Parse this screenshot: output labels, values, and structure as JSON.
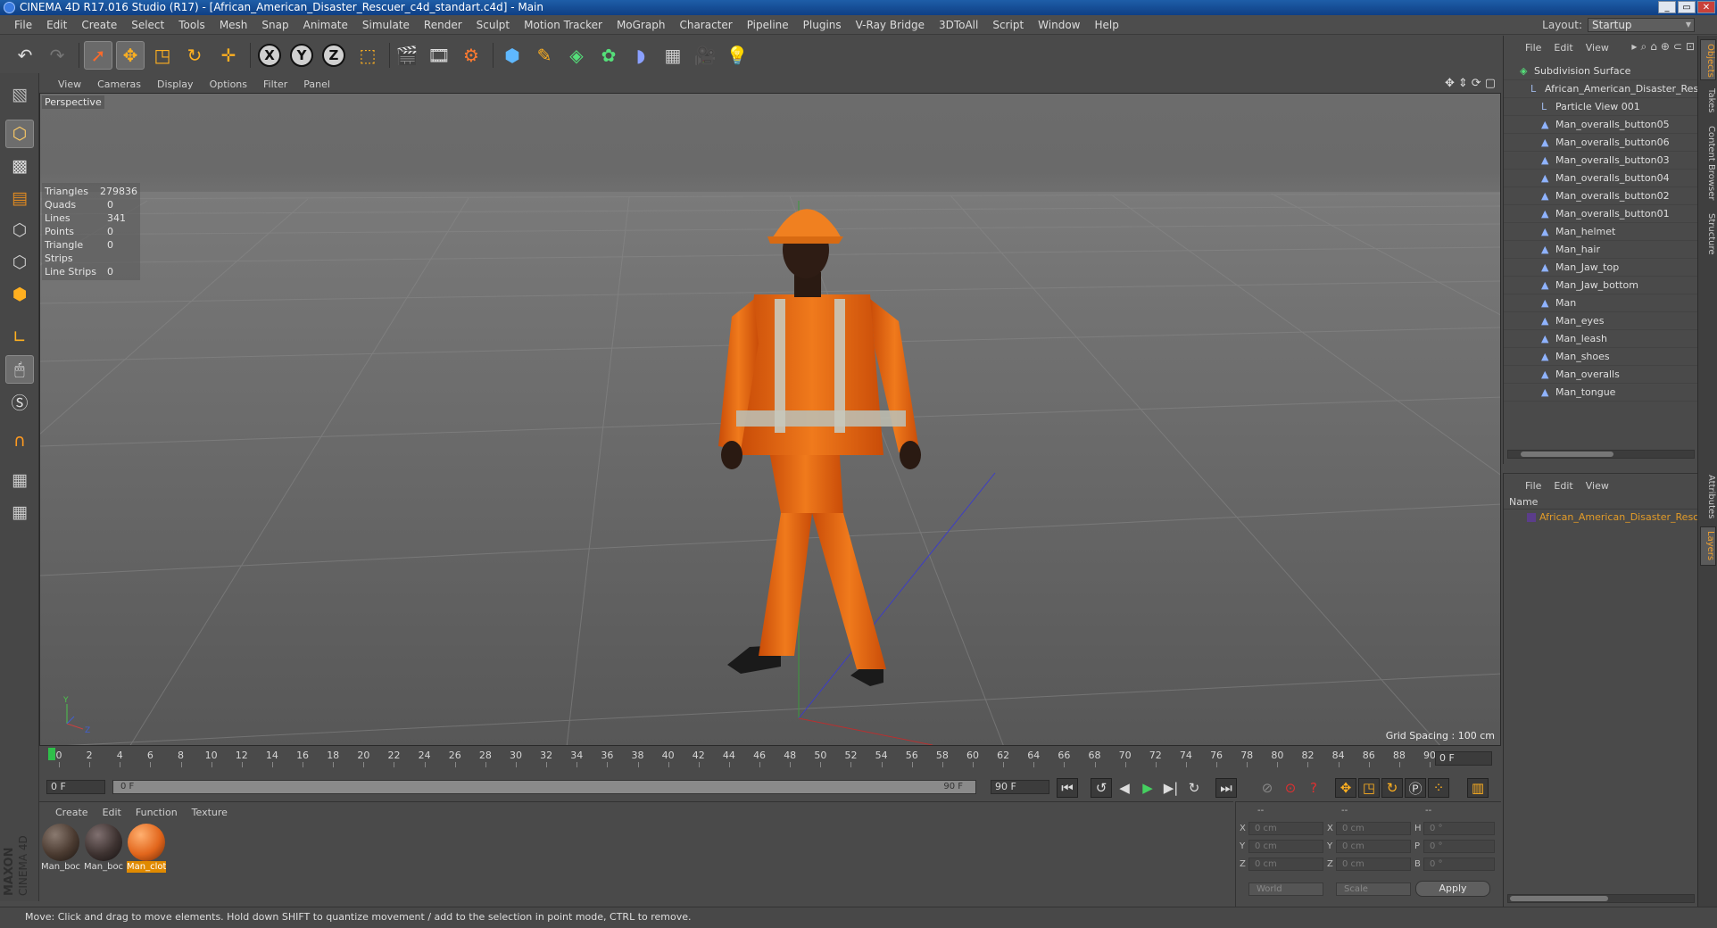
{
  "window": {
    "title": "CINEMA 4D R17.016 Studio (R17) - [African_American_Disaster_Rescuer_c4d_standart.c4d] - Main"
  },
  "menubar": {
    "items": [
      "File",
      "Edit",
      "Create",
      "Select",
      "Tools",
      "Mesh",
      "Snap",
      "Animate",
      "Simulate",
      "Render",
      "Sculpt",
      "Motion Tracker",
      "MoGraph",
      "Character",
      "Pipeline",
      "Plugins",
      "V-Ray Bridge",
      "3DToAll",
      "Script",
      "Window",
      "Help"
    ],
    "layout_label": "Layout:",
    "layout_value": "Startup"
  },
  "toolbar": {
    "axis_x": "X",
    "axis_y": "Y",
    "axis_z": "Z"
  },
  "viewport": {
    "menu": [
      "View",
      "Cameras",
      "Display",
      "Options",
      "Filter",
      "Panel"
    ],
    "label": "Perspective",
    "stats": [
      {
        "k": "Triangles",
        "v": "279836"
      },
      {
        "k": "Quads",
        "v": "0"
      },
      {
        "k": "Lines",
        "v": "341"
      },
      {
        "k": "Points",
        "v": "0"
      },
      {
        "k": "Triangle Strips",
        "v": "0"
      },
      {
        "k": "Line Strips",
        "v": "0"
      }
    ],
    "grid_spacing": "Grid Spacing : 100 cm",
    "gizmo_y": "Y",
    "gizmo_z": "Z"
  },
  "timeline": {
    "ticks": [
      "0",
      "2",
      "4",
      "6",
      "8",
      "10",
      "12",
      "14",
      "16",
      "18",
      "20",
      "22",
      "24",
      "26",
      "28",
      "30",
      "32",
      "34",
      "36",
      "38",
      "40",
      "42",
      "44",
      "46",
      "48",
      "50",
      "52",
      "54",
      "56",
      "58",
      "60",
      "62",
      "64",
      "66",
      "68",
      "70",
      "72",
      "74",
      "76",
      "78",
      "80",
      "82",
      "84",
      "86",
      "88",
      "90"
    ],
    "current_frame": "0 F"
  },
  "transport": {
    "start_field": "0 F",
    "range_left": "0 F",
    "range_right": "90 F",
    "end_field": "90 F"
  },
  "material_manager": {
    "menu": [
      "Create",
      "Edit",
      "Function",
      "Texture"
    ],
    "materials": [
      {
        "name": "Man_boc",
        "selected": false,
        "color": "#4a3a30"
      },
      {
        "name": "Man_boc",
        "selected": false,
        "color": "#3d3230"
      },
      {
        "name": "Man_clot",
        "selected": true,
        "color": "#e2661c"
      }
    ]
  },
  "coordinates": {
    "header": [
      "--",
      "--",
      "--"
    ],
    "rows": [
      {
        "a": "X",
        "av": "0 cm",
        "b": "X",
        "bv": "0 cm",
        "c": "H",
        "cv": "0 °"
      },
      {
        "a": "Y",
        "av": "0 cm",
        "b": "Y",
        "bv": "0 cm",
        "c": "P",
        "cv": "0 °"
      },
      {
        "a": "Z",
        "av": "0 cm",
        "b": "Z",
        "bv": "0 cm",
        "c": "B",
        "cv": "0 °"
      }
    ],
    "mode_world": "World",
    "mode_scale": "Scale",
    "apply": "Apply"
  },
  "object_manager": {
    "menu": [
      "File",
      "Edit",
      "View"
    ],
    "objects": [
      {
        "name": "Subdivision Surface",
        "indent": 0,
        "icon": "subdivision-icon"
      },
      {
        "name": "African_American_Disaster_Rescuer",
        "indent": 1,
        "icon": "null-icon"
      },
      {
        "name": "Particle View 001",
        "indent": 2,
        "icon": "null-icon"
      },
      {
        "name": "Man_overalls_button05",
        "indent": 2,
        "icon": "polygon-icon"
      },
      {
        "name": "Man_overalls_button06",
        "indent": 2,
        "icon": "polygon-icon"
      },
      {
        "name": "Man_overalls_button03",
        "indent": 2,
        "icon": "polygon-icon"
      },
      {
        "name": "Man_overalls_button04",
        "indent": 2,
        "icon": "polygon-icon"
      },
      {
        "name": "Man_overalls_button02",
        "indent": 2,
        "icon": "polygon-icon"
      },
      {
        "name": "Man_overalls_button01",
        "indent": 2,
        "icon": "polygon-icon"
      },
      {
        "name": "Man_helmet",
        "indent": 2,
        "icon": "polygon-icon"
      },
      {
        "name": "Man_hair",
        "indent": 2,
        "icon": "polygon-icon"
      },
      {
        "name": "Man_Jaw_top",
        "indent": 2,
        "icon": "polygon-icon"
      },
      {
        "name": "Man_Jaw_bottom",
        "indent": 2,
        "icon": "polygon-icon"
      },
      {
        "name": "Man",
        "indent": 2,
        "icon": "polygon-icon"
      },
      {
        "name": "Man_eyes",
        "indent": 2,
        "icon": "polygon-icon"
      },
      {
        "name": "Man_leash",
        "indent": 2,
        "icon": "polygon-icon"
      },
      {
        "name": "Man_shoes",
        "indent": 2,
        "icon": "polygon-icon"
      },
      {
        "name": "Man_overalls",
        "indent": 2,
        "icon": "polygon-icon"
      },
      {
        "name": "Man_tongue",
        "indent": 2,
        "icon": "polygon-icon"
      }
    ]
  },
  "layer_manager": {
    "menu": [
      "File",
      "Edit",
      "View"
    ],
    "header": "Name",
    "layer": "African_American_Disaster_Rescuer"
  },
  "right_tabs": [
    "Objects",
    "Takes",
    "Content Browser",
    "Structure",
    "Attributes",
    "Layers"
  ],
  "status": {
    "text": "Move: Click and drag to move elements. Hold down SHIFT to quantize movement / add to the selection in point mode, CTRL to remove."
  }
}
